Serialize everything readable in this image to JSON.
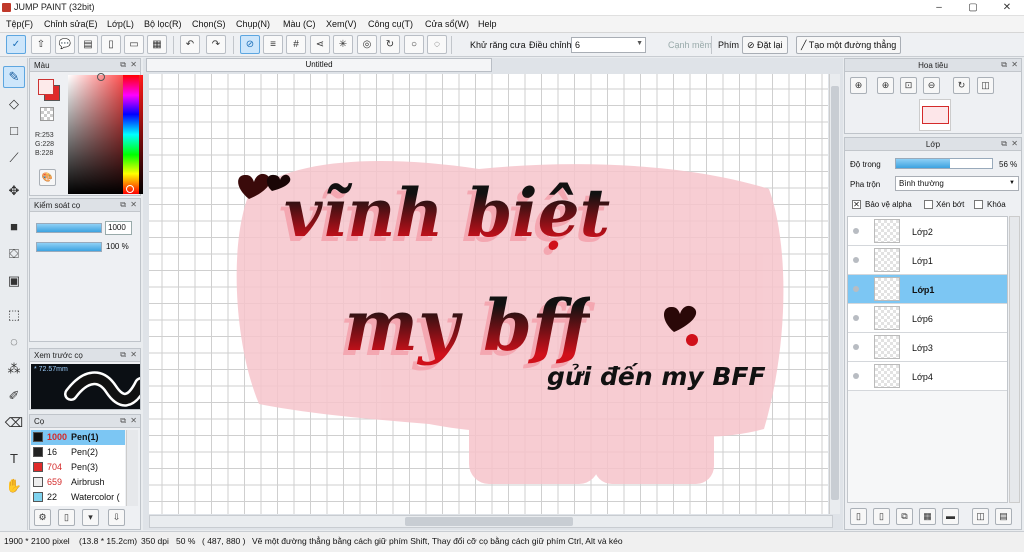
{
  "window": {
    "title": "JUMP PAINT (32bit)",
    "minimize": "–",
    "maximize": "▢",
    "close": "✕"
  },
  "menu": [
    "Tệp(F)",
    "Chỉnh sửa(E)",
    "Lớp(L)",
    "Bộ lọc(R)",
    "Chọn(S)",
    "Chụp(N)",
    "Màu (C)",
    "Xem(V)",
    "Công cụ(T)",
    "Cửa sổ(W)",
    "Help"
  ],
  "toolbar": {
    "antialias_label": "Khử răng cưa",
    "antialias_checked": "✕",
    "adjust_label": "Điều chỉnh",
    "adjust_value": "6",
    "smooth_label": "Cạnh mềm",
    "key_label": "Phím",
    "reset_label": "Đặt lại",
    "line_label": "Tạo một đường thẳng"
  },
  "panels": {
    "color": {
      "title": "Màu",
      "r": "R:253",
      "g": "G:228",
      "b": "B:228"
    },
    "brush_control": {
      "title": "Kiểm soát cọ",
      "size": "1000",
      "opacity": "100 %",
      "size_level": 1.0,
      "opacity_level": 1.0
    },
    "brush_preview": {
      "title": "Xem trước cọ",
      "size_readout": "* 72.57mm"
    },
    "brushes": {
      "title": "Cọ",
      "items": [
        {
          "size": "1000",
          "name": "Pen(1)",
          "color": "#111111",
          "selected": true
        },
        {
          "size": "16",
          "name": "Pen(2)",
          "color": "#222222",
          "selected": false
        },
        {
          "size": "704",
          "name": "Pen(3)",
          "color": "#e02a2a",
          "selected": false
        },
        {
          "size": "659",
          "name": "Airbrush",
          "color": "#eeeeee",
          "selected": false
        },
        {
          "size": "22",
          "name": "Watercolor (",
          "color": "#7fd3ef",
          "selected": false
        }
      ]
    },
    "navigator": {
      "title": "Hoa tiêu"
    },
    "layers": {
      "title": "Lớp",
      "opacity_label": "Độ trong",
      "opacity_value": "56 %",
      "opacity_level": 0.56,
      "blend_label": "Pha trộn",
      "blend_value": "Bình thường",
      "protect_alpha": "Bảo vệ alpha",
      "protect_alpha_checked": "✕",
      "clip": "Xén bớt",
      "lock": "Khóa",
      "items": [
        {
          "name": "Lớp2",
          "selected": false
        },
        {
          "name": "Lớp1",
          "selected": false
        },
        {
          "name": "Lớp1",
          "selected": true
        },
        {
          "name": "Lớp6",
          "selected": false
        },
        {
          "name": "Lớp3",
          "selected": false
        },
        {
          "name": "Lớp4",
          "selected": false
        }
      ]
    }
  },
  "document": {
    "tab_title": "Untitled",
    "art_line1": "vĩnh biệt",
    "art_line2": "my bff",
    "art_line3": "gửi đến my BFF"
  },
  "status": {
    "size": "1900 * 2100 pixel",
    "cm": "(13.8 * 15.2cm)",
    "dpi": "350 dpi",
    "zoom": "50 %",
    "coords": "( 487, 880 )",
    "hint": "Vẽ một đường thẳng bằng cách giữ phím Shift, Thay đổi cỡ cọ bằng cách giữ phím Ctrl, Alt và kéo"
  },
  "colors": {
    "primary": "#e02a2a",
    "accent_selection": "#7cc6f3",
    "ink": "#111111"
  }
}
